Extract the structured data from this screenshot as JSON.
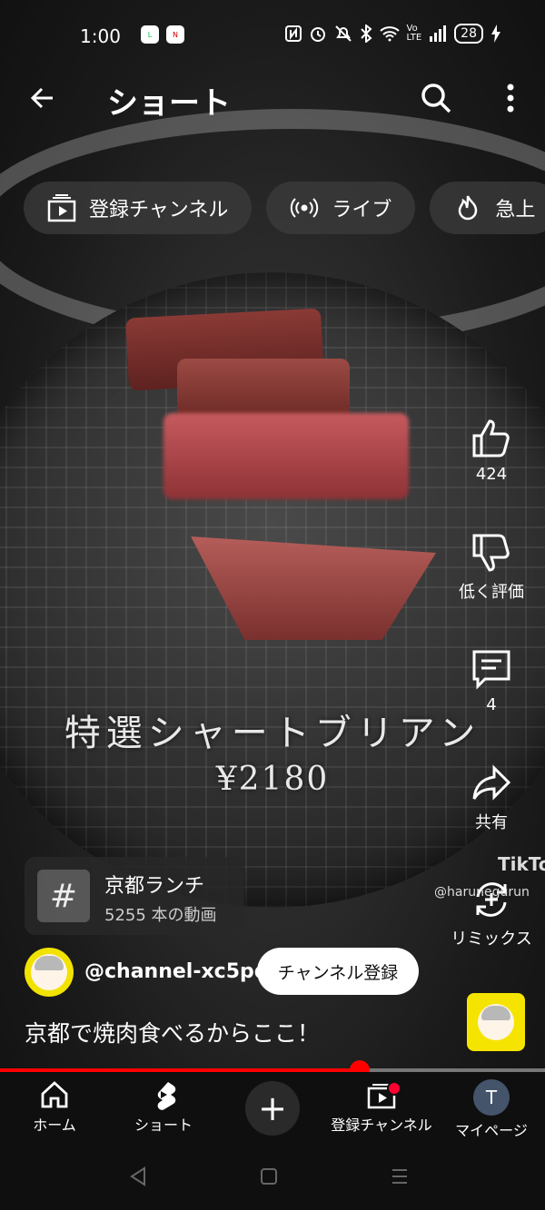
{
  "status_bar": {
    "time": "1:00",
    "app_icons": [
      "line-icon",
      "news-app-icon"
    ],
    "battery": "28",
    "system_icons": [
      "nfc-icon",
      "alarm-icon",
      "mute-icon",
      "bluetooth-icon",
      "wifi-icon",
      "volte-icon",
      "signal-icon",
      "charging-icon"
    ]
  },
  "header": {
    "title": "ショート"
  },
  "chips": [
    {
      "label": "登録チャンネル",
      "icon": "subscriptions-icon"
    },
    {
      "label": "ライブ",
      "icon": "live-icon"
    },
    {
      "label": "急上",
      "icon": "trending-icon"
    }
  ],
  "video": {
    "overlay_text": "特選シャートブリアン",
    "overlay_price": "¥2180",
    "tiktok_mark": "TikTo",
    "tiktok_user": "@harunegurun"
  },
  "rail": {
    "like_count": "424",
    "dislike_label": "低く評価",
    "comment_count": "4",
    "share_label": "共有",
    "remix_label": "リミックス"
  },
  "hashtag": {
    "title": "京都ランチ",
    "subtitle": "5255 本の動画"
  },
  "channel": {
    "handle": "@channel-xc5pd",
    "subscribe_label": "チャンネル登録"
  },
  "caption": "京都で焼肉食べるからここ！",
  "progress": {
    "fraction": 0.66
  },
  "bottom_nav": {
    "home": "ホーム",
    "shorts": "ショート",
    "subscriptions": "登録チャンネル",
    "you": "マイページ",
    "avatar_letter": "T"
  },
  "colors": {
    "accent": "#ff0000",
    "background": "#0f0f0f",
    "subscribe_bg": "#ffffff"
  }
}
